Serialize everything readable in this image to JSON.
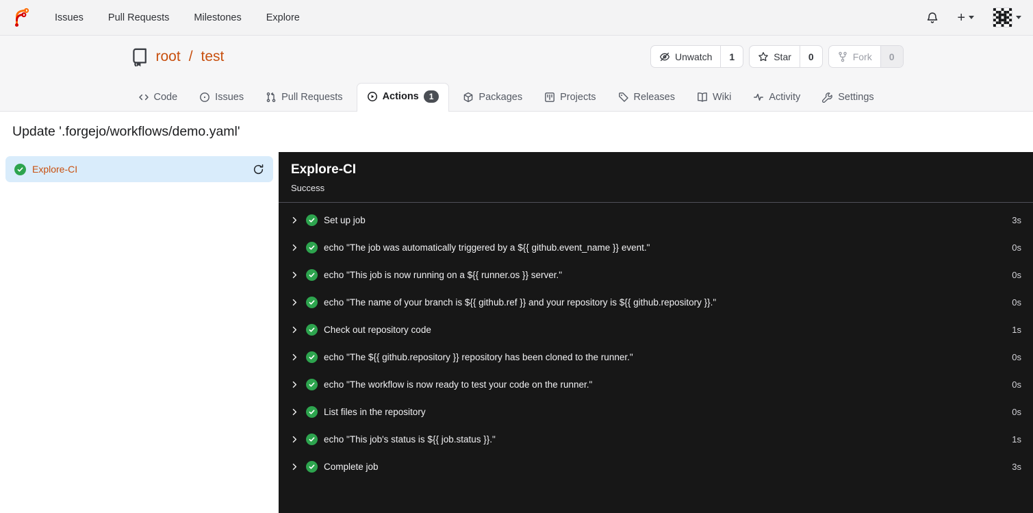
{
  "navbar": {
    "items": [
      {
        "label": "Issues"
      },
      {
        "label": "Pull Requests"
      },
      {
        "label": "Milestones"
      },
      {
        "label": "Explore"
      }
    ]
  },
  "repo": {
    "owner": "root",
    "separator": "/",
    "name": "test",
    "buttons": {
      "watch": {
        "label": "Unwatch",
        "count": "1"
      },
      "star": {
        "label": "Star",
        "count": "0"
      },
      "fork": {
        "label": "Fork",
        "count": "0",
        "disabled": true
      }
    }
  },
  "tabs": [
    {
      "label": "Code"
    },
    {
      "label": "Issues"
    },
    {
      "label": "Pull Requests"
    },
    {
      "label": "Actions",
      "count": "1",
      "active": true
    },
    {
      "label": "Packages"
    },
    {
      "label": "Projects"
    },
    {
      "label": "Releases"
    },
    {
      "label": "Wiki"
    },
    {
      "label": "Activity"
    },
    {
      "label": "Settings"
    }
  ],
  "run": {
    "title": "Update '.forgejo/workflows/demo.yaml'",
    "job": {
      "name": "Explore-CI",
      "status": "success"
    },
    "log_header": {
      "title": "Explore-CI",
      "status": "Success"
    },
    "steps": [
      {
        "name": "Set up job",
        "duration": "3s"
      },
      {
        "name": "echo \"The job was automatically triggered by a ${{ github.event_name }} event.\"",
        "duration": "0s"
      },
      {
        "name": "echo \"This job is now running on a ${{ runner.os }} server.\"",
        "duration": "0s"
      },
      {
        "name": "echo \"The name of your branch is ${{ github.ref }} and your repository is ${{ github.repository }}.\"",
        "duration": "0s"
      },
      {
        "name": "Check out repository code",
        "duration": "1s"
      },
      {
        "name": "echo \"The ${{ github.repository }} repository has been cloned to the runner.\"",
        "duration": "0s"
      },
      {
        "name": "echo \"The workflow is now ready to test your code on the runner.\"",
        "duration": "0s"
      },
      {
        "name": "List files in the repository",
        "duration": "0s"
      },
      {
        "name": "echo \"This job's status is ${{ job.status }}.\"",
        "duration": "1s"
      },
      {
        "name": "Complete job",
        "duration": "3s"
      }
    ]
  },
  "icons": {
    "logo": "forgejo-logo",
    "notifications": "bell-icon",
    "create_new": "plus-icon",
    "account": "avatar-identicon",
    "repo": "book-icon",
    "watch": "eye-slash-icon",
    "star": "star-icon",
    "fork": "git-fork-icon",
    "job_status": "check-circle-icon",
    "rerun": "sync-icon",
    "step_expand": "chevron-right-icon"
  },
  "colors": {
    "accent": "#c8500f",
    "success": "#2da44e",
    "selected_bg": "#d9ecfb",
    "panel_bg": "#171717",
    "panel_border": "#50505a",
    "navbar_bg": "#f3f3f4",
    "header_bg": "#f6f6f7",
    "border": "#e2e2e6",
    "badge_bg": "#4a4e54"
  }
}
